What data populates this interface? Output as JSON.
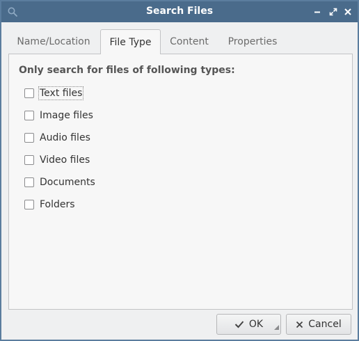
{
  "window": {
    "title": "Search Files",
    "icons": {
      "app": "search-icon",
      "minimize": "minimize-icon",
      "maximize": "maximize-icon",
      "close": "close-icon"
    }
  },
  "tabs": [
    {
      "label": "Name/Location",
      "active": false
    },
    {
      "label": "File Type",
      "active": true
    },
    {
      "label": "Content",
      "active": false
    },
    {
      "label": "Properties",
      "active": false
    }
  ],
  "file_type": {
    "heading": "Only search for files of following types:",
    "options": [
      {
        "label": "Text files",
        "checked": false
      },
      {
        "label": "Image files",
        "checked": false
      },
      {
        "label": "Audio files",
        "checked": false
      },
      {
        "label": "Video files",
        "checked": false
      },
      {
        "label": "Documents",
        "checked": false
      },
      {
        "label": "Folders",
        "checked": false
      }
    ]
  },
  "buttons": {
    "ok": "OK",
    "cancel": "Cancel"
  },
  "colors": {
    "titlebar": "#4a6b8b",
    "window_bg": "#eff0f1",
    "panel_bg": "#f7f7f7"
  }
}
